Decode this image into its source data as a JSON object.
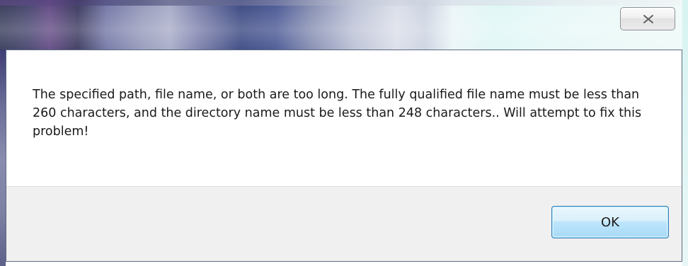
{
  "dialog": {
    "message": "The specified path, file name, or both are too long. The fully qualified file name must be less than 260 characters, and the directory name must be less than 248 characters.. Will attempt to fix this problem!",
    "ok_label": "OK",
    "close_icon": "close-x-icon"
  },
  "colors": {
    "button_area": "#f0f0f0",
    "ok_button_border": "#3c7fb1",
    "ok_button_fill": "#bee6fd",
    "window_border": "#5d6b82"
  }
}
